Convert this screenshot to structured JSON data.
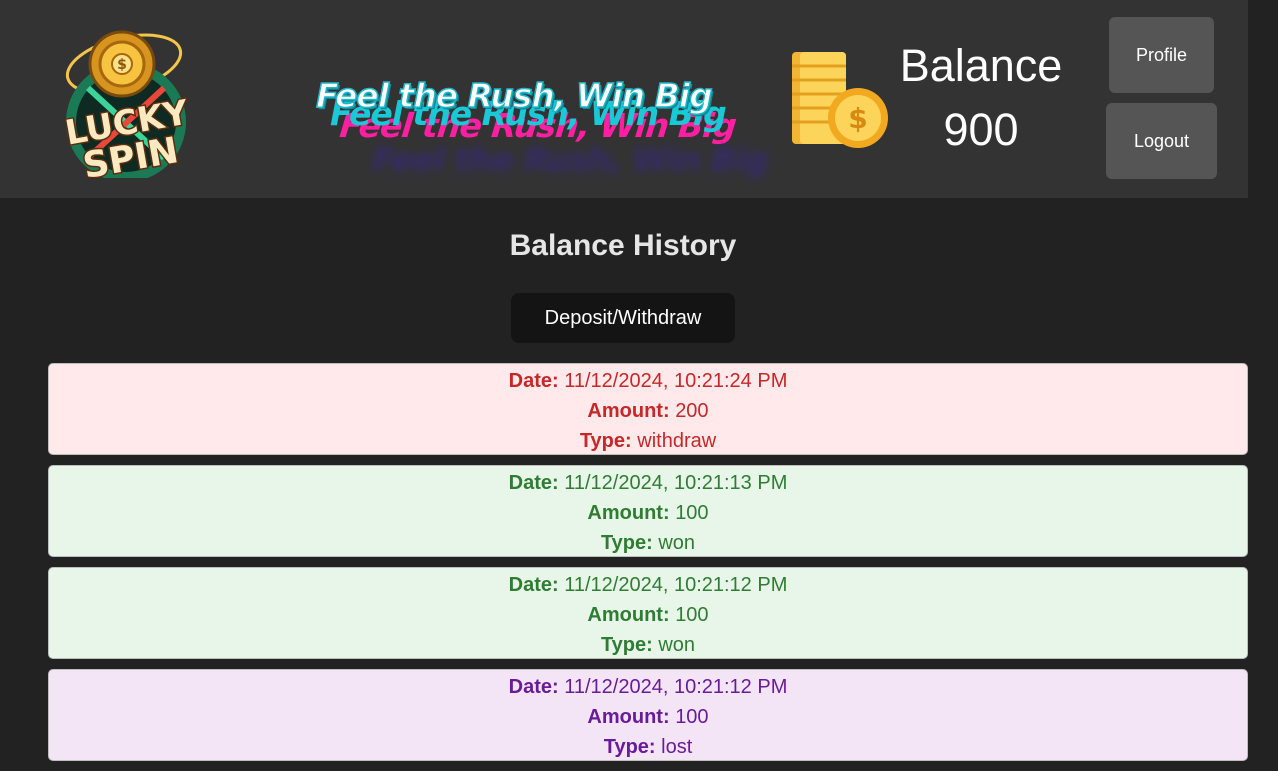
{
  "header": {
    "slogan": "Feel the Rush, Win Big",
    "logo_text": [
      "LUCKY",
      "SPIN"
    ],
    "balance_label": "Balance",
    "balance_value": "900",
    "profile_label": "Profile",
    "logout_label": "Logout",
    "icons": {
      "logo": "lucky-spin-logo",
      "coins": "coin-stack-icon"
    }
  },
  "main": {
    "title": "Balance History",
    "deposit_withdraw_label": "Deposit/Withdraw",
    "field_labels": {
      "date": "Date:",
      "amount": "Amount:",
      "type": "Type:"
    },
    "entries": [
      {
        "date": "11/12/2024, 10:21:24 PM",
        "amount": "200",
        "type": "withdraw"
      },
      {
        "date": "11/12/2024, 10:21:13 PM",
        "amount": "100",
        "type": "won"
      },
      {
        "date": "11/12/2024, 10:21:12 PM",
        "amount": "100",
        "type": "won"
      },
      {
        "date": "11/12/2024, 10:21:12 PM",
        "amount": "100",
        "type": "lost"
      }
    ]
  },
  "colors": {
    "page_background": "#222222",
    "header_background": "#333333",
    "button_gray": "#555555",
    "withdraw_bg": "#ffe9eb",
    "withdraw_text": "#c62828",
    "won_bg": "#e8f5e9",
    "won_text": "#2e7d32",
    "lost_bg": "#f3e5f5",
    "lost_text": "#6a1b9a"
  }
}
